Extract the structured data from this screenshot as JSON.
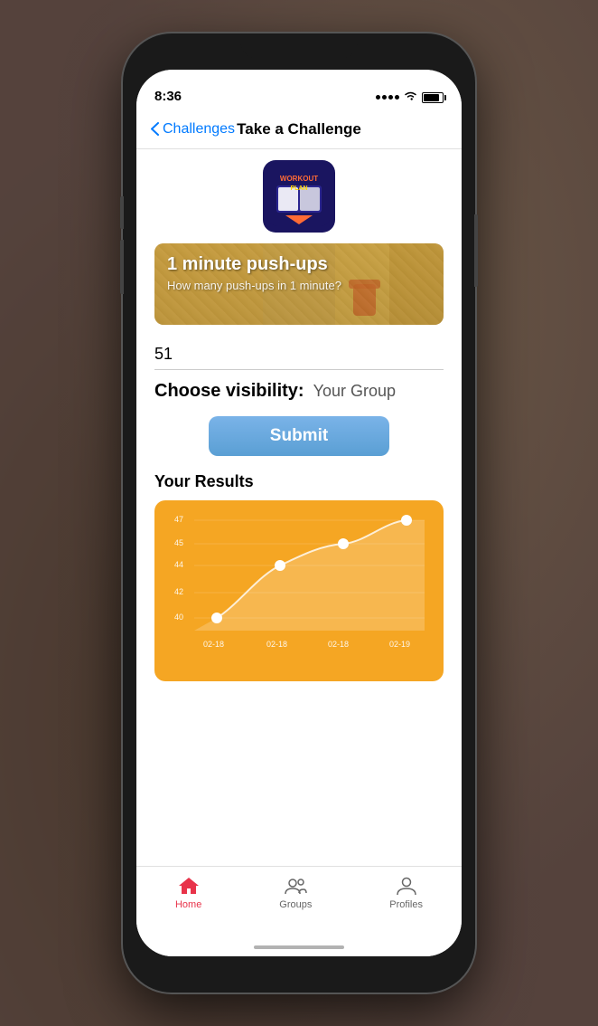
{
  "phone": {
    "status_bar": {
      "time": "8:36"
    },
    "nav": {
      "back_label": "Challenges",
      "title": "Take a Challenge"
    },
    "app_icon": {
      "line1": "WORKOUT",
      "line2": "PLAN"
    },
    "challenge_banner": {
      "title": "1 minute push-ups",
      "subtitle": "How many push-ups in 1 minute?"
    },
    "result_input": {
      "value": "51"
    },
    "visibility": {
      "label": "Choose visibility:",
      "value": "Your Group"
    },
    "submit_button": {
      "label": "Submit"
    },
    "results": {
      "title": "Your Results",
      "chart": {
        "y_labels": [
          "47",
          "45",
          "44",
          "42",
          "40"
        ],
        "x_labels": [
          "02-18",
          "02-18",
          "02-18",
          "02-19"
        ],
        "data_points": [
          {
            "x": 0,
            "y": 40
          },
          {
            "x": 1,
            "y": 44
          },
          {
            "x": 2,
            "y": 45
          },
          {
            "x": 3,
            "y": 47
          }
        ]
      }
    },
    "tab_bar": {
      "items": [
        {
          "label": "Home",
          "active": true
        },
        {
          "label": "Groups",
          "active": false
        },
        {
          "label": "Profiles",
          "active": false
        }
      ]
    }
  }
}
